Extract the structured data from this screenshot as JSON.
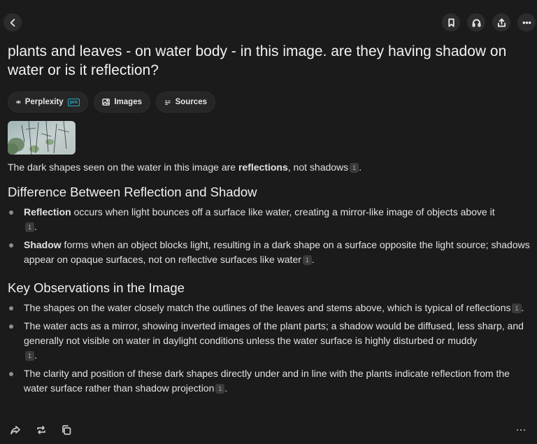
{
  "question": "plants and leaves - on water body - in this image. are they having shadow on water or is it reflection?",
  "chips": [
    {
      "label": "Perplexity",
      "badge": "pro"
    },
    {
      "label": "Images"
    },
    {
      "label": "Sources"
    }
  ],
  "answer": {
    "intro_before": "The dark shapes seen on the water in this image are ",
    "intro_bold": "reflections",
    "intro_after": ", not shadows",
    "cite": "1",
    "period": ".",
    "section1": {
      "heading": "Difference Between Reflection and Shadow",
      "items": [
        {
          "bold": "Reflection",
          "text": " occurs when light bounces off a surface like water, creating a mirror-like image of objects above it",
          "cite": "1"
        },
        {
          "bold": "Shadow",
          "text": " forms when an object blocks light, resulting in a dark shape on a surface opposite the light source; shadows appear on opaque surfaces, not on reflective surfaces like water",
          "cite": "1"
        }
      ]
    },
    "section2": {
      "heading": "Key Observations in the Image",
      "items": [
        {
          "text": "The shapes on the water closely match the outlines of the leaves and stems above, which is typical of reflections",
          "cite": "1"
        },
        {
          "text": "The water acts as a mirror, showing inverted images of the plant parts; a shadow would be diffused, less sharp, and generally not visible on water in daylight conditions unless the water surface is highly disturbed or muddy",
          "cite": "1"
        },
        {
          "text": "The clarity and position of these dark shapes directly under and in line with the plants indicate reflection from the water surface rather than shadow projection",
          "cite": "1"
        }
      ]
    }
  },
  "icons": {
    "back": "chevron-left-icon",
    "bookmark": "bookmark-icon",
    "headphones": "headphones-icon",
    "share": "share-icon",
    "more": "more-icon",
    "forward": "share-arrow-icon",
    "rewrite": "repeat-icon",
    "copy": "copy-icon"
  },
  "colors": {
    "background": "#1b1b1b",
    "accent": "#2aa9c9"
  }
}
